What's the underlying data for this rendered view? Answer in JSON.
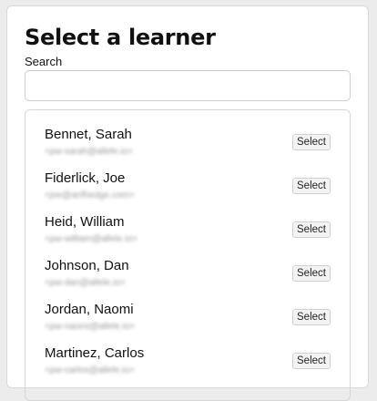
{
  "page": {
    "title": "Select a learner",
    "search_label": "Search",
    "search_value": "",
    "search_placeholder": ""
  },
  "learners": [
    {
      "name": "Bennet, Sarah",
      "email": "<pw-sarah@allele.io>",
      "button": "Select"
    },
    {
      "name": "Fiderlick, Joe",
      "email": "<joe@anfhedge.com>",
      "button": "Select"
    },
    {
      "name": "Heid, William",
      "email": "<pw-william@allele.io>",
      "button": "Select"
    },
    {
      "name": "Johnson, Dan",
      "email": "<pw-dan@allele.io>",
      "button": "Select"
    },
    {
      "name": "Jordan, Naomi",
      "email": "<pw-naomi@allele.io>",
      "button": "Select"
    },
    {
      "name": "Martinez, Carlos",
      "email": "<pw-carlos@allele.io>",
      "button": "Select"
    }
  ]
}
